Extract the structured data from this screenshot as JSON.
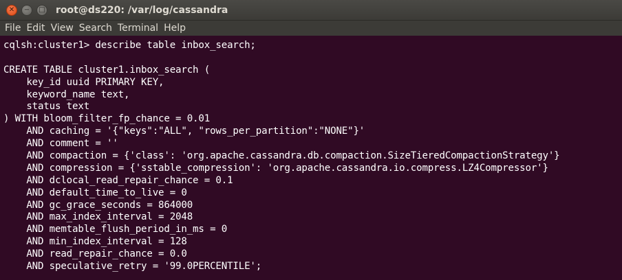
{
  "window": {
    "title": "root@ds220: /var/log/cassandra",
    "close_glyph": "✕",
    "minimize_glyph": "−",
    "maximize_glyph": "□"
  },
  "menubar": {
    "items": [
      "File",
      "Edit",
      "View",
      "Search",
      "Terminal",
      "Help"
    ]
  },
  "terminal": {
    "lines": [
      "cqlsh:cluster1> describe table inbox_search;",
      "",
      "CREATE TABLE cluster1.inbox_search (",
      "    key_id uuid PRIMARY KEY,",
      "    keyword_name text,",
      "    status text",
      ") WITH bloom_filter_fp_chance = 0.01",
      "    AND caching = '{\"keys\":\"ALL\", \"rows_per_partition\":\"NONE\"}'",
      "    AND comment = ''",
      "    AND compaction = {'class': 'org.apache.cassandra.db.compaction.SizeTieredCompactionStrategy'}",
      "    AND compression = {'sstable_compression': 'org.apache.cassandra.io.compress.LZ4Compressor'}",
      "    AND dclocal_read_repair_chance = 0.1",
      "    AND default_time_to_live = 0",
      "    AND gc_grace_seconds = 864000",
      "    AND max_index_interval = 2048",
      "    AND memtable_flush_period_in_ms = 0",
      "    AND min_index_interval = 128",
      "    AND read_repair_chance = 0.0",
      "    AND speculative_retry = '99.0PERCENTILE';"
    ]
  }
}
